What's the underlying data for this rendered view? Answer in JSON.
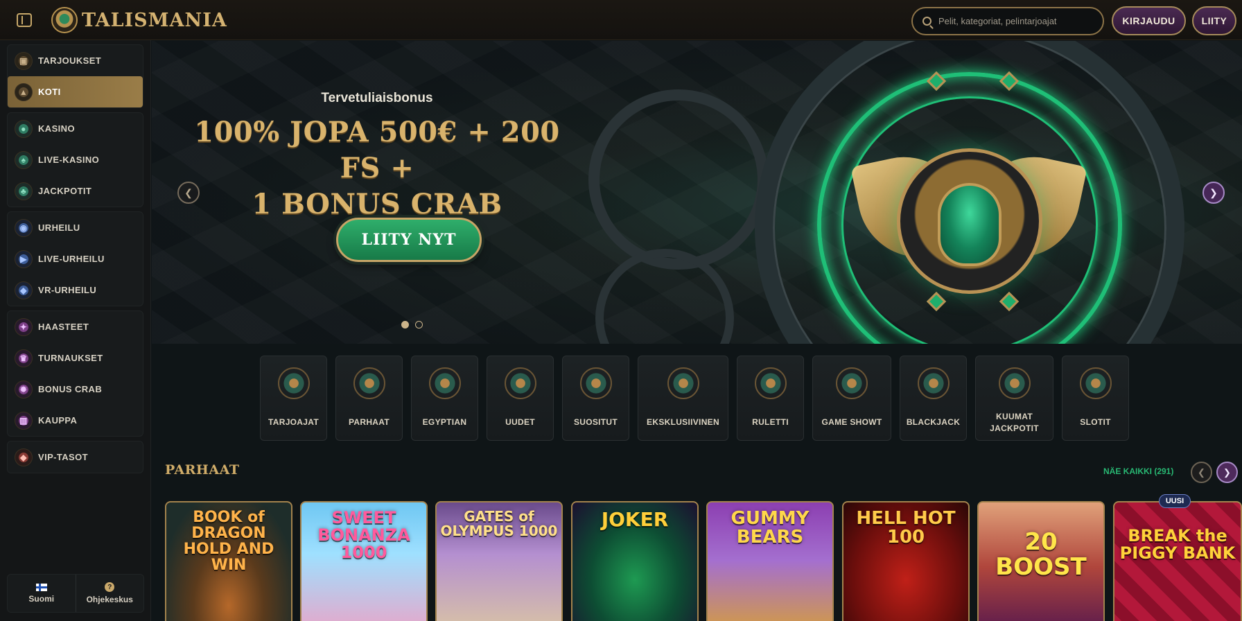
{
  "header": {
    "brand": "TALISMANIA",
    "search_placeholder": "Pelit, kategoriat, pelintarjoajat",
    "login_label": "KIRJAUDU",
    "join_label": "LIITY"
  },
  "sidebar": {
    "items": [
      {
        "label": "TARJOUKSET",
        "icon": "gift-icon"
      },
      {
        "label": "KOTI",
        "icon": "home-icon"
      },
      {
        "label": "KASINO",
        "icon": "casino-chip-icon"
      },
      {
        "label": "LIVE-KASINO",
        "icon": "spade-icon"
      },
      {
        "label": "JACKPOTIT",
        "icon": "clover-icon"
      },
      {
        "label": "URHEILU",
        "icon": "soccer-ball-icon"
      },
      {
        "label": "LIVE-URHEILU",
        "icon": "play-icon"
      },
      {
        "label": "VR-URHEILU",
        "icon": "gamepad-icon"
      },
      {
        "label": "HAASTEET",
        "icon": "challenge-icon"
      },
      {
        "label": "TURNAUKSET",
        "icon": "trophy-icon"
      },
      {
        "label": "BONUS CRAB",
        "icon": "crab-icon"
      },
      {
        "label": "KAUPPA",
        "icon": "shop-icon"
      },
      {
        "label": "VIP-TASOT",
        "icon": "diamond-icon"
      }
    ],
    "active": "KOTI",
    "language_label": "Suomi",
    "help_label": "Ohjekeskus"
  },
  "hero": {
    "subtitle": "Tervetuliaisbonus",
    "title_line1": "100% JOPA 500€ + 200 FS +",
    "title_line2": "1 BONUS CRAB",
    "cta_label": "LIITY NYT",
    "slides": 2,
    "active_slide": 1
  },
  "categories": [
    {
      "label": "TARJOAJAT"
    },
    {
      "label": "PARHAAT"
    },
    {
      "label": "EGYPTIAN"
    },
    {
      "label": "UUDET"
    },
    {
      "label": "SUOSITUT"
    },
    {
      "label": "EKSKLUSIIVINEN"
    },
    {
      "label": "RULETTI"
    },
    {
      "label": "GAME SHOWT"
    },
    {
      "label": "BLACKJACK"
    },
    {
      "label": "KUUMAT JACKPOTIT"
    },
    {
      "label": "SLOTIT"
    }
  ],
  "section": {
    "title": "PARHAAT",
    "see_all_label": "NÄE KAIKKI (291)"
  },
  "games": [
    {
      "title": "BOOK of DRAGON HOLD AND WIN"
    },
    {
      "title": "SWEET BONANZA 1000"
    },
    {
      "title": "GATES of OLYMPUS 1000"
    },
    {
      "title": "JOKER"
    },
    {
      "title": "GUMMY BEARS"
    },
    {
      "title": "HELL HOT 100"
    },
    {
      "title": "20 BOOST"
    },
    {
      "title": "BREAK the PIGGY BANK"
    }
  ],
  "new_badge": "UUSI",
  "colors": {
    "gold": "#d1ad69",
    "accent_green": "#28b873",
    "purple_button": "#4a2a52",
    "background": "#0f1517"
  }
}
